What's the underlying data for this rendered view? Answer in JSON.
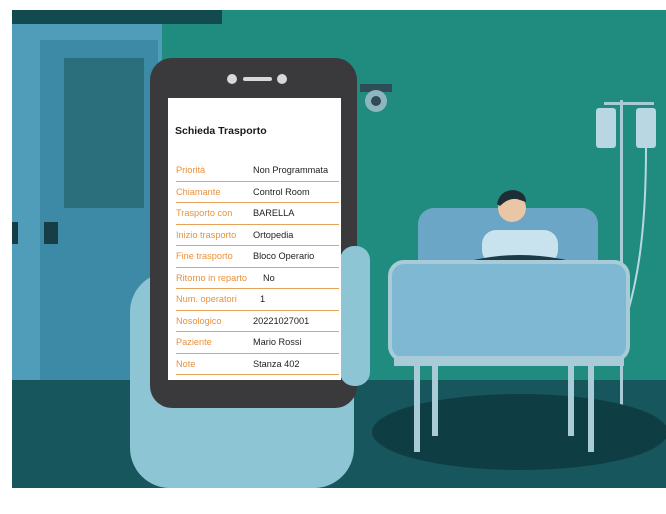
{
  "colors": {
    "wall": "#1f8c7f",
    "floor": "#17565d",
    "accent_orange": "#e8913d",
    "phone_frame": "#3a3a3d"
  },
  "form": {
    "title": "Schieda Trasporto",
    "rows": [
      {
        "label": "Priorità",
        "value": "Non Programmata"
      },
      {
        "label": "Chiamante",
        "value": "Control Room"
      },
      {
        "label": "Trasporto con",
        "value": "BARELLA"
      },
      {
        "label": "Inizio trasporto",
        "value": "Ortopedia"
      },
      {
        "label": "Fine trasporto",
        "value": "Bloco Operario"
      },
      {
        "label": "Ritorno in reparto",
        "value": "No"
      },
      {
        "label": "Num. operatori",
        "value": "1"
      },
      {
        "label": "Nosologico",
        "value": "20221027001"
      },
      {
        "label": "Paziente",
        "value": "Mario Rossi"
      },
      {
        "label": "Note",
        "value": "Stanza 402"
      }
    ]
  }
}
